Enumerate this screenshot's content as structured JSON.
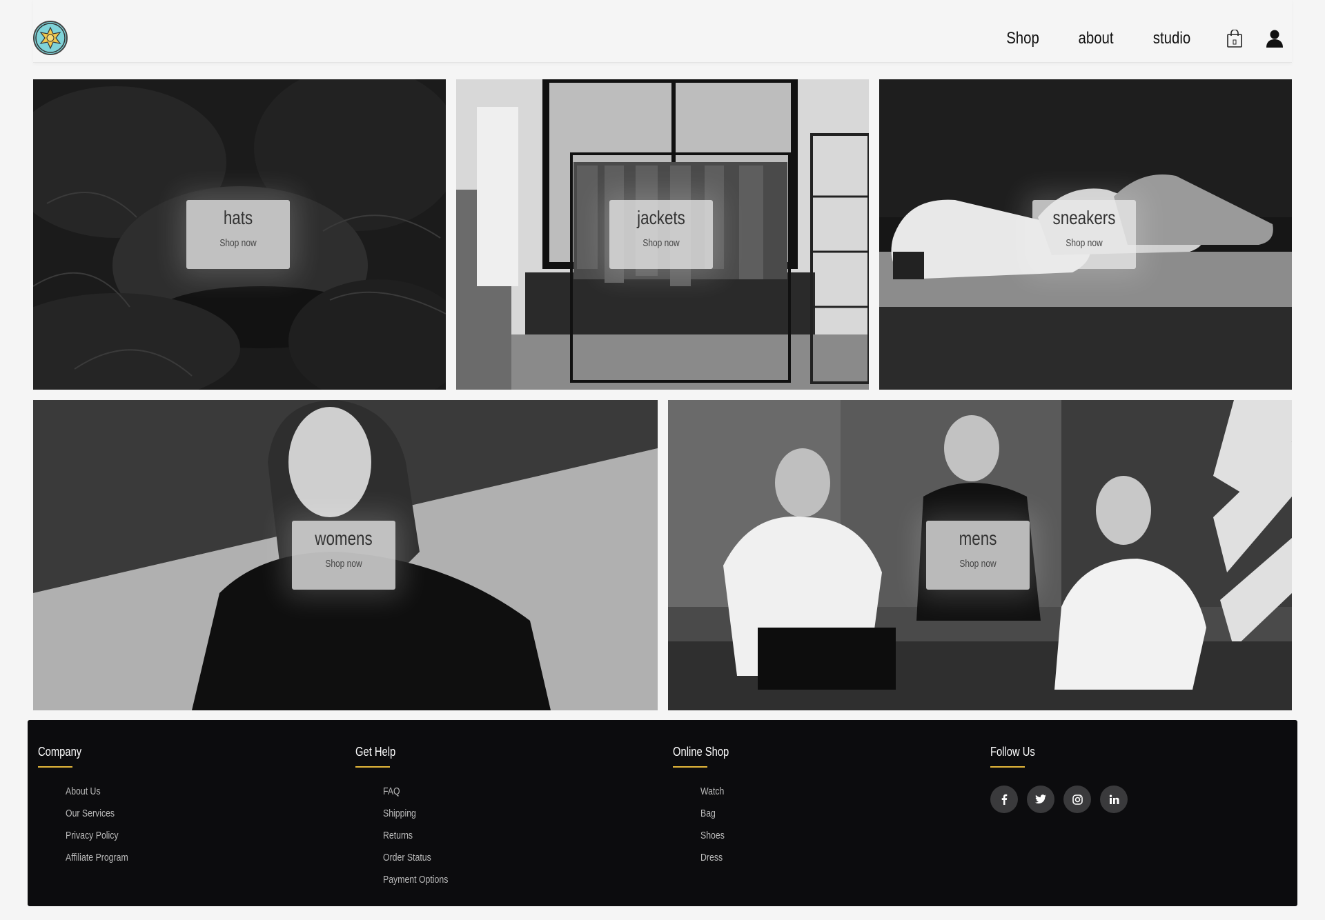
{
  "nav": {
    "items": [
      "Shop",
      "about",
      "studio"
    ]
  },
  "tiles": [
    {
      "category": "hats",
      "cta": "Shop now"
    },
    {
      "category": "jackets",
      "cta": "Shop now"
    },
    {
      "category": "sneakers",
      "cta": "Shop now"
    },
    {
      "category": "womens",
      "cta": "Shop now"
    },
    {
      "category": "mens",
      "cta": "Shop now"
    }
  ],
  "footer": {
    "columns": [
      {
        "title": "Company",
        "links": [
          "About Us",
          "Our Services",
          "Privacy Policy",
          "Affiliate Program"
        ]
      },
      {
        "title": "Get Help",
        "links": [
          "FAQ",
          "Shipping",
          "Returns",
          "Order Status",
          "Payment Options"
        ]
      },
      {
        "title": "Online Shop",
        "links": [
          "Watch",
          "Bag",
          "Shoes",
          "Dress"
        ]
      },
      {
        "title": "Follow Us",
        "social": [
          "f",
          "t",
          "ig",
          "in"
        ]
      }
    ]
  },
  "colors": {
    "accent": "#e6b93a",
    "footer_bg": "#0c0c0e",
    "logo_bg": "#7fd3d8"
  },
  "icons": {
    "cart": "shopping-bag-icon",
    "user": "user-icon",
    "social": [
      "facebook-icon",
      "twitter-icon",
      "instagram-icon",
      "linkedin-icon"
    ]
  }
}
